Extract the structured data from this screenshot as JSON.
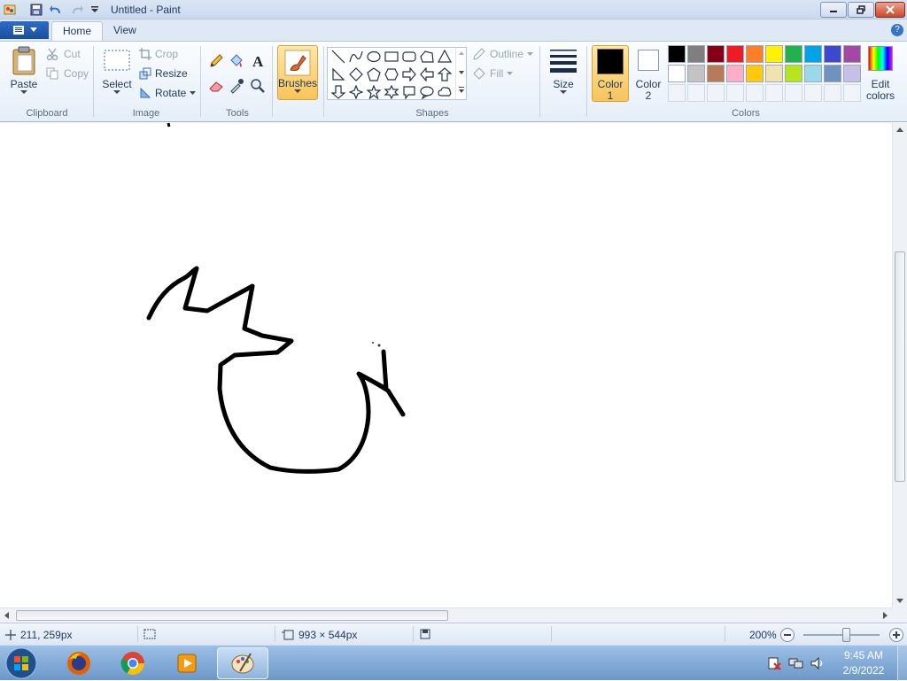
{
  "window": {
    "title": "Untitled - Paint"
  },
  "tabs": {
    "home": "Home",
    "view": "View"
  },
  "clipboard": {
    "paste": "Paste",
    "cut": "Cut",
    "copy": "Copy",
    "label": "Clipboard"
  },
  "image": {
    "select": "Select",
    "crop": "Crop",
    "resize": "Resize",
    "rotate": "Rotate",
    "label": "Image"
  },
  "tools": {
    "label": "Tools"
  },
  "brushes": {
    "label": "Brushes"
  },
  "shapes": {
    "outline": "Outline",
    "fill": "Fill",
    "label": "Shapes"
  },
  "size": {
    "label": "Size"
  },
  "color1": {
    "line1": "Color",
    "line2": "1",
    "value": "#000000"
  },
  "color2": {
    "line1": "Color",
    "line2": "2",
    "value": "#ffffff"
  },
  "colors": {
    "label": "Colors",
    "edit_line1": "Edit",
    "edit_line2": "colors",
    "palette_row1": [
      "#000000",
      "#7f7f7f",
      "#880015",
      "#ed1c24",
      "#ff7f27",
      "#fff200",
      "#22b14c",
      "#00a2e8",
      "#3f48cc",
      "#a349a4"
    ],
    "palette_row2": [
      "#ffffff",
      "#c3c3c3",
      "#b97a57",
      "#ffaec9",
      "#ffc90e",
      "#efe4b0",
      "#b5e61d",
      "#99d9ea",
      "#7092be",
      "#c8bfe7"
    ]
  },
  "status": {
    "cursor": "211, 259px",
    "image_size": "993 × 544px",
    "zoom": "200%"
  },
  "taskbar": {
    "time": "9:45 AM",
    "date": "2/9/2022"
  }
}
